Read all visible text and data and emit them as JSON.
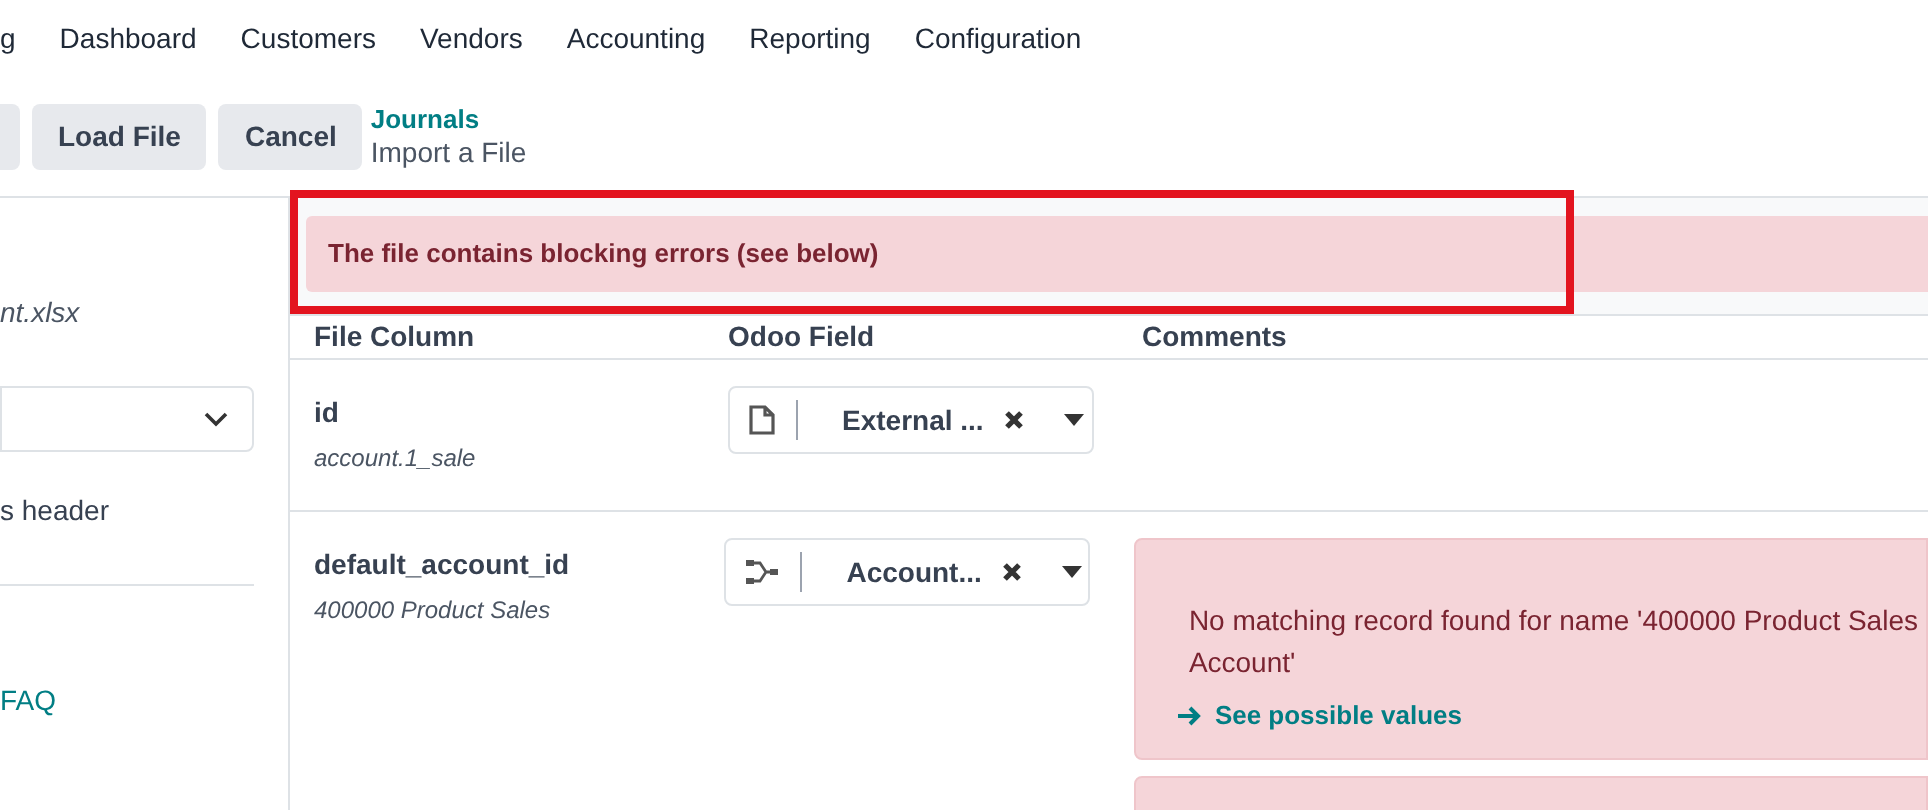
{
  "nav": {
    "items": [
      "g",
      "Dashboard",
      "Customers",
      "Vendors",
      "Accounting",
      "Reporting",
      "Configuration"
    ]
  },
  "toolbar": {
    "buttons": [
      "Load File",
      "Cancel"
    ]
  },
  "breadcrumb": {
    "parent": "Journals",
    "current": "Import a File"
  },
  "sidebar": {
    "file_name": "nt.xlsx",
    "header_option": "s header",
    "help_link": "FAQ"
  },
  "alert": {
    "message": "The file contains blocking errors (see below)",
    "highlighted": true
  },
  "table": {
    "columns": [
      "File Column",
      "Odoo Field",
      "Comments"
    ],
    "rows": [
      {
        "column": "id",
        "sample": "account.1_sale",
        "field": {
          "kind": "document",
          "value": "External ..."
        },
        "comments": []
      },
      {
        "column": "default_account_id",
        "sample": "400000 Product Sales",
        "field": {
          "kind": "relation",
          "value": "Account..."
        },
        "comments": [
          {
            "kind": "error",
            "message": "No matching record found for name '400000 Product Sales",
            "message_2": "Account'",
            "link": "See possible values"
          },
          {
            "kind": "error"
          }
        ]
      }
    ]
  }
}
